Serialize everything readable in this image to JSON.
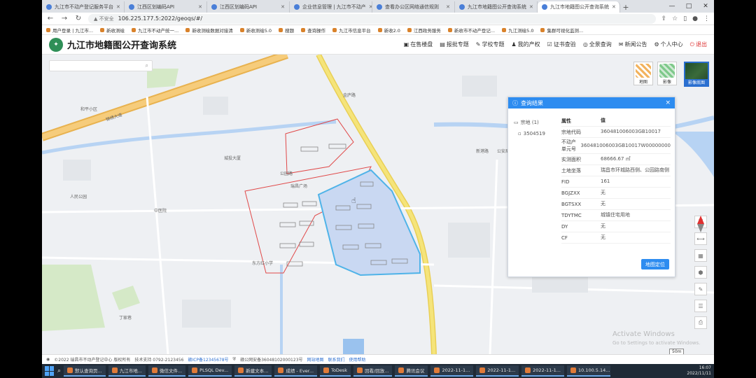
{
  "browser": {
    "tabs": [
      {
        "label": "九江市不动产登记服务平台",
        "active": false
      },
      {
        "label": "江西区划编码API",
        "active": false
      },
      {
        "label": "江西区划编码API",
        "active": false
      },
      {
        "label": "企业信息管理 | 九江市不动产",
        "active": false
      },
      {
        "label": "查看办公区网络通信规则",
        "active": false
      },
      {
        "label": "九江市地籍图公开查询系统",
        "active": false
      },
      {
        "label": "九江市地籍图公开查询系统",
        "active": true
      }
    ],
    "new_tab": "+",
    "window_controls": [
      "—",
      "□",
      "✕"
    ],
    "nav": {
      "back": "←",
      "forward": "→",
      "reload": "↻"
    },
    "url_insecure": "▲ 不安全",
    "url": "106.225.177.5:2022/geoqs/#/",
    "bookmarks": [
      "用户登录 | 九江市...",
      "新收测绘",
      "九江市不动产统一...",
      "新收测绘数据对接清",
      "新收测绘5.0",
      "搜题",
      "查询操作",
      "九江市信息平台",
      "新收2.0",
      "江西政务服务",
      "新收市不动产登记...",
      "九江测绘5.0",
      "集群可视化监测..."
    ]
  },
  "app": {
    "logo_text": "✦",
    "title": "九江市地籍图公开查询系统",
    "nav": [
      {
        "label": "在售楼盘",
        "icon": "▣"
      },
      {
        "label": "报批专题",
        "icon": "▤"
      },
      {
        "label": "学校专题",
        "icon": "✎"
      },
      {
        "label": "我的产权",
        "icon": "♟"
      },
      {
        "label": "证书查验",
        "icon": "☑"
      },
      {
        "label": "全景查询",
        "icon": "◎"
      },
      {
        "label": "新闻公告",
        "icon": "✉"
      },
      {
        "label": "个人中心",
        "icon": "⚙"
      },
      {
        "label": "退出",
        "icon": "⏻"
      }
    ]
  },
  "map": {
    "search_icon": "⌕",
    "layers": [
      {
        "label": "地图"
      },
      {
        "label": "影像"
      }
    ],
    "satellite_label": "影像底图",
    "labels": [
      {
        "text": "锦绣大道"
      },
      {
        "text": "金庐路"
      },
      {
        "text": "公园路"
      },
      {
        "text": "瑞昌广场"
      },
      {
        "text": "东方红小学"
      },
      {
        "text": "和平小区"
      },
      {
        "text": "新港路"
      },
      {
        "text": "人民公园"
      },
      {
        "text": "中医院"
      },
      {
        "text": "丁家巷"
      },
      {
        "text": "公安局"
      },
      {
        "text": "城投大厦"
      }
    ],
    "scale": "50m",
    "watermark_line1": "Activate Windows",
    "watermark_line2": "Go to Settings to activate Windows."
  },
  "panel": {
    "title": "查询结果",
    "close": "×",
    "tree": {
      "root": "宗地 (1)",
      "child": "3504519"
    },
    "header": {
      "k": "属性",
      "v": "值"
    },
    "rows": [
      {
        "k": "宗地代码",
        "v": "360481006003GB10017"
      },
      {
        "k": "不动产单元号",
        "v": "360481006003GB10017W00000000"
      },
      {
        "k": "实测面积",
        "v": "68666.67 ㎡"
      },
      {
        "k": "土地坐落",
        "v": "瑞昌市环城路西侧、公园路南侧"
      },
      {
        "k": "FID",
        "v": "161"
      },
      {
        "k": "BGJZXX",
        "v": "无"
      },
      {
        "k": "BGTSXX",
        "v": "无"
      },
      {
        "k": "TDYTMC",
        "v": "城镇住宅用地"
      },
      {
        "k": "DY",
        "v": "无"
      },
      {
        "k": "CF",
        "v": "无"
      }
    ],
    "locate_button": "地图定位"
  },
  "footer": {
    "copyright": "©2022 瑞昌市不动产登记中心 版权所有",
    "support": "技术支持 0792-2123456",
    "icp": "赣ICP备12345678号",
    "police": "赣公网安备36048102000123号",
    "links": [
      "网站地图",
      "联系我们",
      "使用帮助"
    ]
  },
  "taskbar": {
    "items": [
      "默认查询页...",
      "九江市地...",
      "微信文件...",
      "PLSQL Dev...",
      "新建文本...",
      "成绩 - Ever...",
      "ToDesk",
      "回看/回放...",
      "腾讯会议",
      "2022-11-1...",
      "2022-11-1...",
      "2022-11-1...",
      "10.100.5.14..."
    ],
    "time": "16:07",
    "date": "2022/11/11"
  },
  "colors": {
    "accent": "#2d8cf0",
    "parcel_fill": "#c9d8f2",
    "parcel_stroke": "#4fb3e8",
    "boundary_red": "#e04848",
    "road_orange": "#f3c66b",
    "road_yellow": "#f2dd6b",
    "river": "#b7d3f3"
  }
}
